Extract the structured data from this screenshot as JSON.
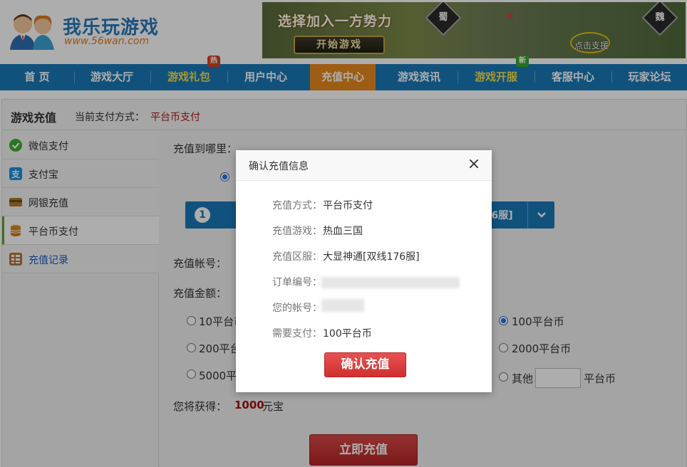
{
  "header": {
    "logo_title": "我乐玩游戏",
    "logo_url": "www.56wan.com",
    "banner": {
      "slogan": "选择加入一方势力",
      "start_button": "开始游戏",
      "faction_shu": "蜀",
      "faction_wei": "魏",
      "support_label": "点击支援"
    }
  },
  "nav": {
    "items": [
      {
        "label": "首 页"
      },
      {
        "label": "游戏大厅"
      },
      {
        "label": "游戏礼包",
        "badge": "热"
      },
      {
        "label": "用户中心"
      },
      {
        "label": "充值中心"
      },
      {
        "label": "游戏资讯"
      },
      {
        "label": "游戏开服",
        "badge": "新"
      },
      {
        "label": "客服中心"
      },
      {
        "label": "玩家论坛"
      }
    ],
    "active_color": "#e8891d",
    "bar_color": "#1a79b8"
  },
  "content": {
    "title": "游戏充值",
    "pay_method_label": "当前支付方式：",
    "pay_method_value": "平台币支付"
  },
  "sidebar": {
    "items": [
      {
        "label": "微信支付",
        "icon": "wechat-icon"
      },
      {
        "label": "支付宝",
        "icon": "alipay-icon"
      },
      {
        "label": "网银充值",
        "icon": "bankcard-icon"
      },
      {
        "label": "平台币支付",
        "icon": "coins-icon"
      },
      {
        "label": "充值记录",
        "icon": "records-icon"
      }
    ]
  },
  "form": {
    "where_label": "充值到哪里：",
    "select_text": "176服]",
    "step_number": "1",
    "account_label": "充值帐号：",
    "amount_label": "充值金额：",
    "amount_options": {
      "o10": "10平台币",
      "o200": "200平台币",
      "o5000": "5000平台币",
      "o100": "100平台币",
      "o2000": "2000平台币",
      "other": "其他",
      "other_unit": "平台币"
    },
    "gain_label": "您将获得：",
    "gain_value": "1000",
    "gain_unit": "元宝",
    "submit": "立即充值"
  },
  "modal": {
    "title": "确认充值信息",
    "close_symbol": "×",
    "rows": {
      "method_label": "充值方式：",
      "method_value": "平台币支付",
      "game_label": "充值游戏：",
      "game_value": "热血三国",
      "server_label": "充值区服：",
      "server_value": "大显神通[双线176服]",
      "order_label": "订单编号：",
      "account_label": "您的帐号：",
      "pay_label": "需要支付：",
      "pay_value": "100平台币"
    },
    "confirm": "确认充值"
  }
}
